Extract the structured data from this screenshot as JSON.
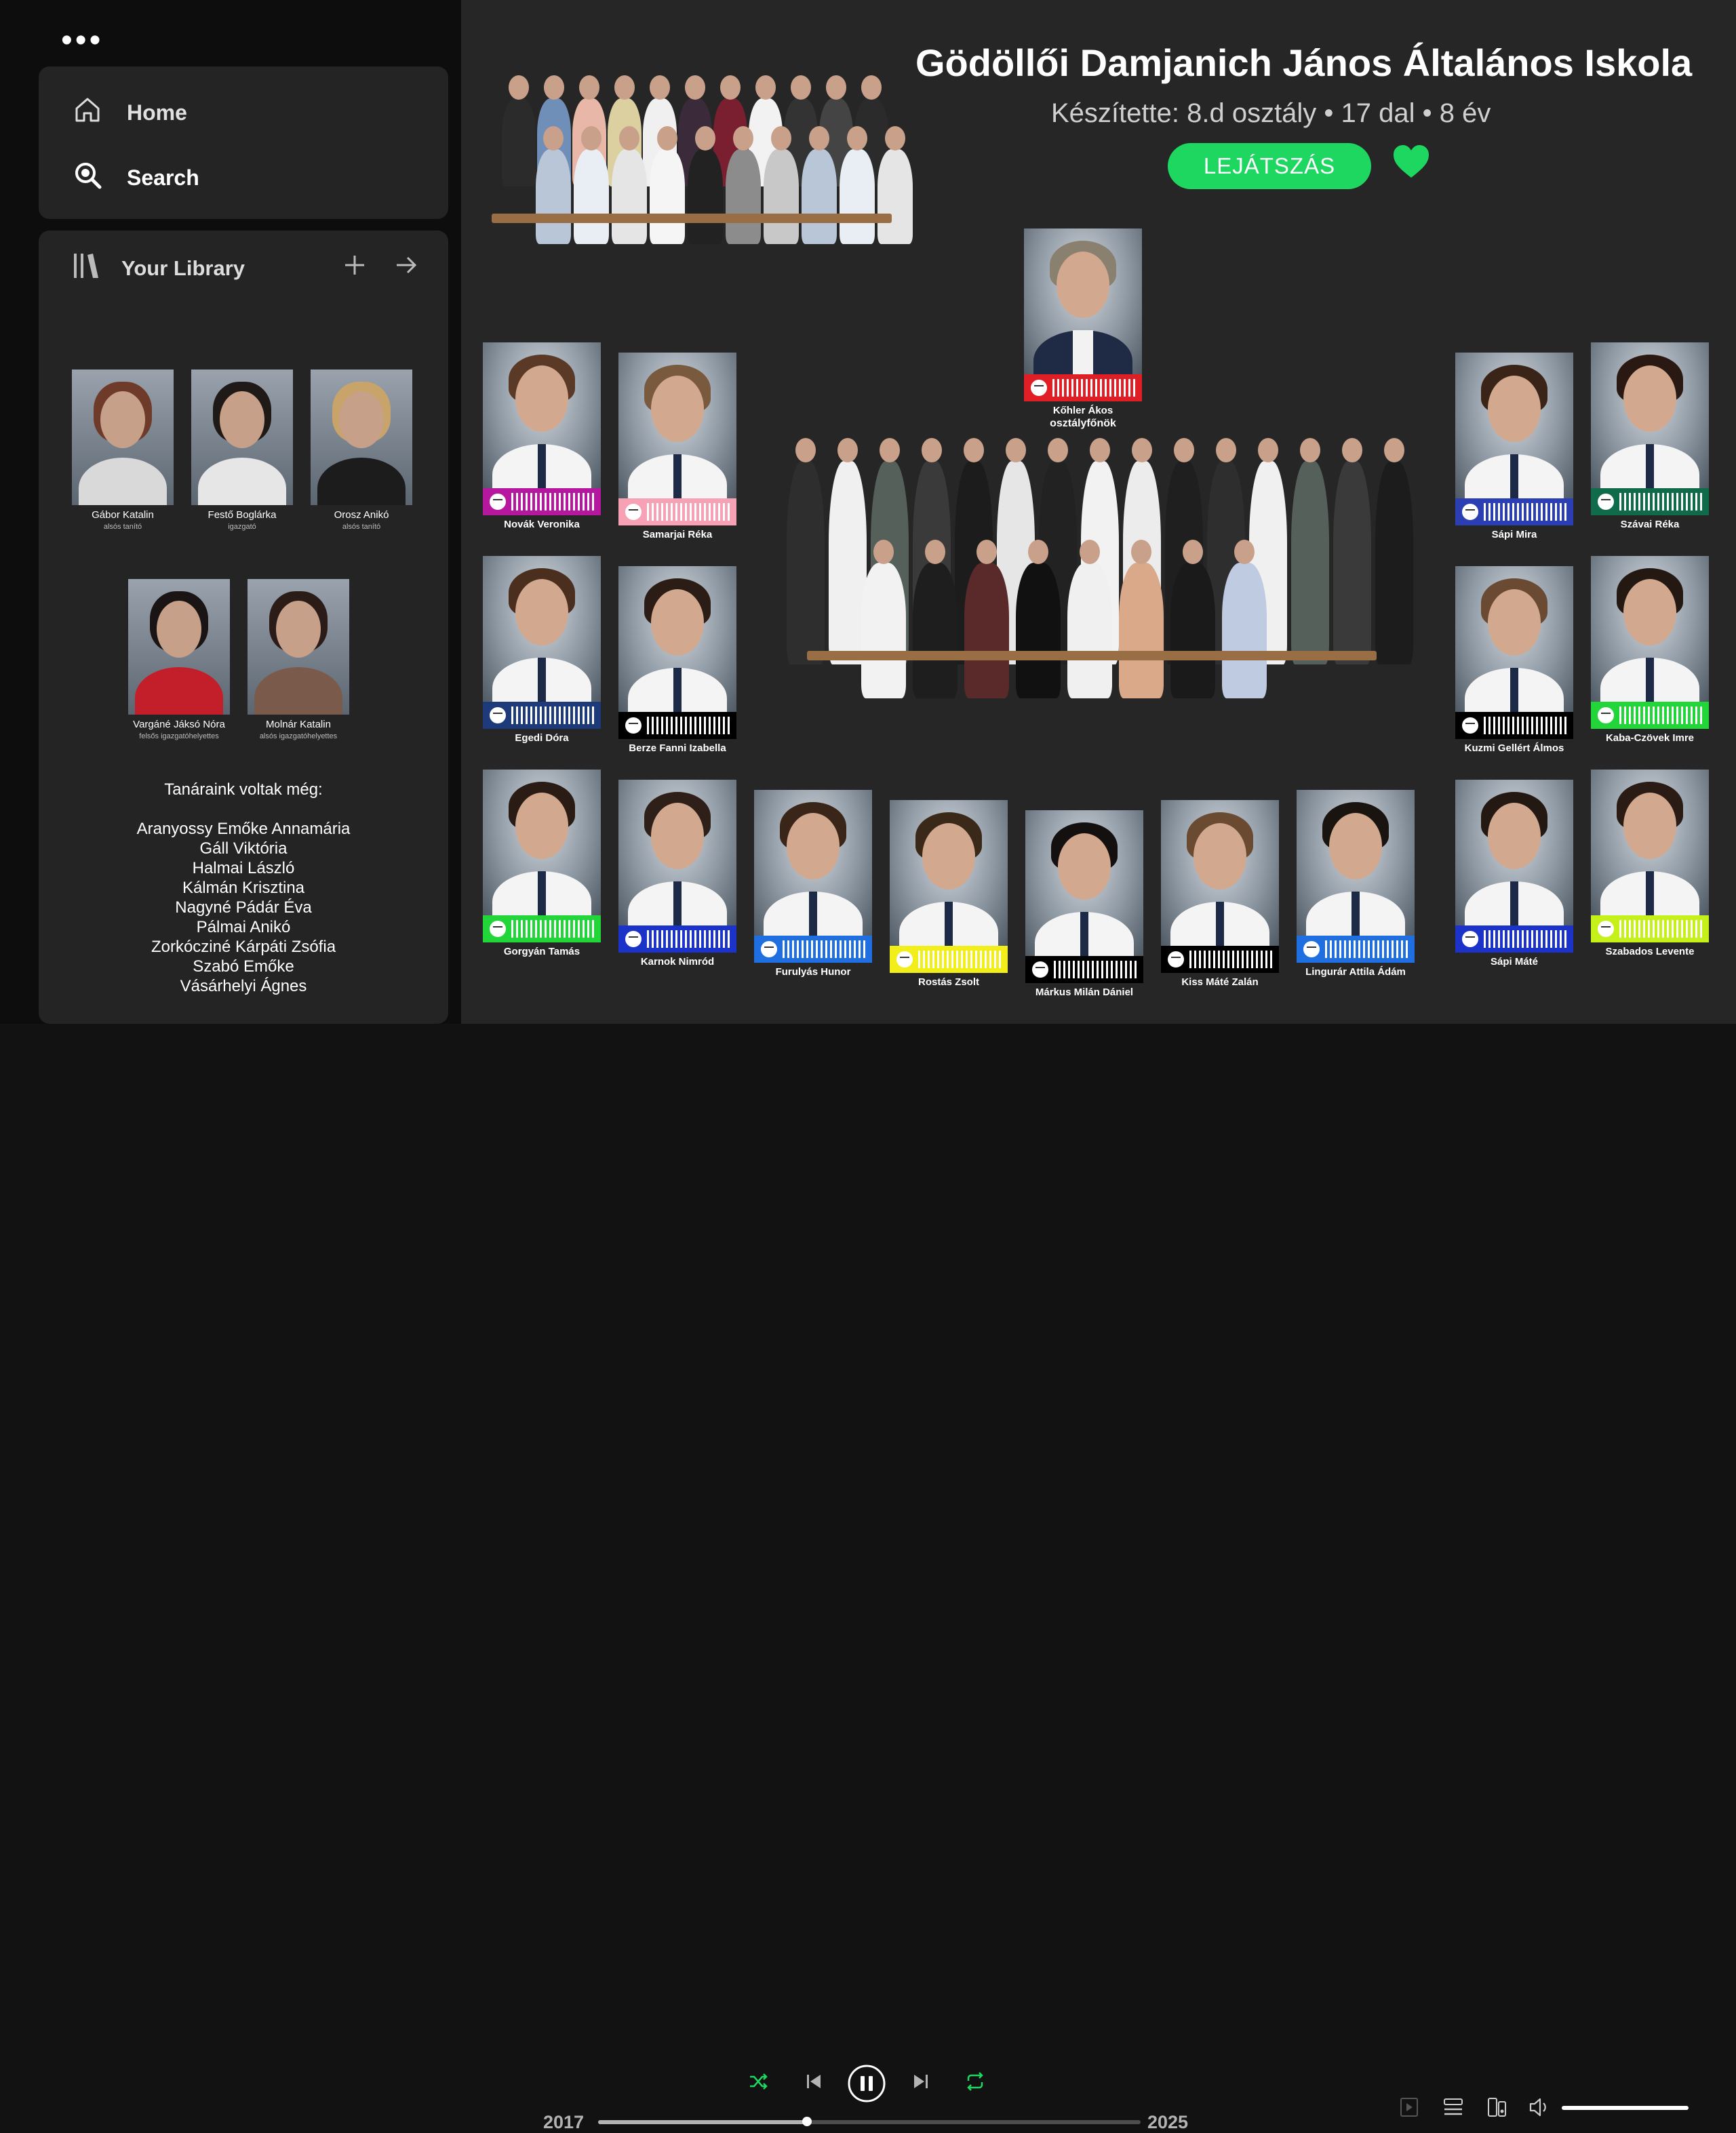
{
  "sidebar": {
    "menu_dots": "•••",
    "nav": [
      {
        "label": "Home",
        "icon": "home-icon"
      },
      {
        "label": "Search",
        "icon": "search-icon"
      }
    ],
    "library_label": "Your Library",
    "staff": [
      {
        "name": "Gábor Katalin",
        "role": "alsós tanító",
        "hair": "#6e3a2a",
        "top": "#d9d9d9"
      },
      {
        "name": "Festő Boglárka",
        "role": "igazgató",
        "hair": "#1f1a18",
        "top": "#e6e6e6"
      },
      {
        "name": "Orosz Anikó",
        "role": "alsós tanító",
        "hair": "#c9a46a",
        "top": "#1c1c1c"
      },
      {
        "name": "Vargáné Jáksó Nóra",
        "role": "felsős igazgatóhelyettes",
        "hair": "#1a1414",
        "top": "#c21f2b"
      },
      {
        "name": "Molnár Katalin",
        "role": "alsós igazgatóhelyettes",
        "hair": "#2b1c18",
        "top": "#7a5a4a"
      }
    ],
    "former_title": "Tanáraink voltak még:",
    "former": [
      "Aranyossy Emőke Annamária",
      "Gáll Viktória",
      "Halmai László",
      "Kálmán Krisztina",
      "Nagyné Pádár Éva",
      "Pálmai Anikó",
      "Zorkócziné Kárpáti Zsófia",
      "Szabó Emőke",
      "Vásárhelyi Ágnes"
    ]
  },
  "header": {
    "title": "Gödöllői Damjanich János Általános Iskola",
    "subtitle": "Készítette: 8.d osztály • 17 dal • 8 év",
    "play_label": "LEJÁTSZÁS"
  },
  "teacher": {
    "name": "Kőhler Ákos",
    "role": "osztályfőnök",
    "code_color": "#e01e26"
  },
  "students": [
    {
      "name": "Novák Veronika",
      "code_color": "#b5179e",
      "hair": "#5a3a26"
    },
    {
      "name": "Samarjai Réka",
      "code_color": "#f7a1b5",
      "hair": "#7a5a3e"
    },
    {
      "name": "Sápi Mira",
      "code_color": "#2b3fb3",
      "hair": "#3a2418"
    },
    {
      "name": "Szávai Réka",
      "code_color": "#0f6b4a",
      "hair": "#2a1812"
    },
    {
      "name": "Egedi Dóra",
      "code_color": "#1d3a7a",
      "hair": "#4a2e1e"
    },
    {
      "name": "Berze Fanni Izabella",
      "code_color": "#000000",
      "hair": "#2b1d16"
    },
    {
      "name": "Kuzmi Gellért Álmos",
      "code_color": "#000000",
      "hair": "#6a4a32"
    },
    {
      "name": "Kaba-Czövek Imre",
      "code_color": "#22d63a",
      "hair": "#241812"
    },
    {
      "name": "Gorgyán Tamás",
      "code_color": "#22d63a",
      "hair": "#2a1c14"
    },
    {
      "name": "Karnok Nimród",
      "code_color": "#1c33c9",
      "hair": "#2e2018"
    },
    {
      "name": "Furulyás Hunor",
      "code_color": "#1f6fe0",
      "hair": "#3a2618"
    },
    {
      "name": "Rostás Zsolt",
      "code_color": "#f2ee1a",
      "hair": "#3a2818"
    },
    {
      "name": "Márkus Milán Dániel",
      "code_color": "#000000",
      "hair": "#141010"
    },
    {
      "name": "Kiss Máté Zalán",
      "code_color": "#000000",
      "hair": "#6a4a30"
    },
    {
      "name": "Lingurár Attila Ádám",
      "code_color": "#1f6fe0",
      "hair": "#1a1410"
    },
    {
      "name": "Sápi Máté",
      "code_color": "#1c33c9",
      "hair": "#241812"
    },
    {
      "name": "Szabados Levente",
      "code_color": "#c6f01a",
      "hair": "#2a1c14"
    }
  ],
  "player": {
    "start_label": "2017",
    "end_label": "2025",
    "progress": 0.385,
    "volume": 1.0
  },
  "colors": {
    "accent": "#1ed760"
  }
}
